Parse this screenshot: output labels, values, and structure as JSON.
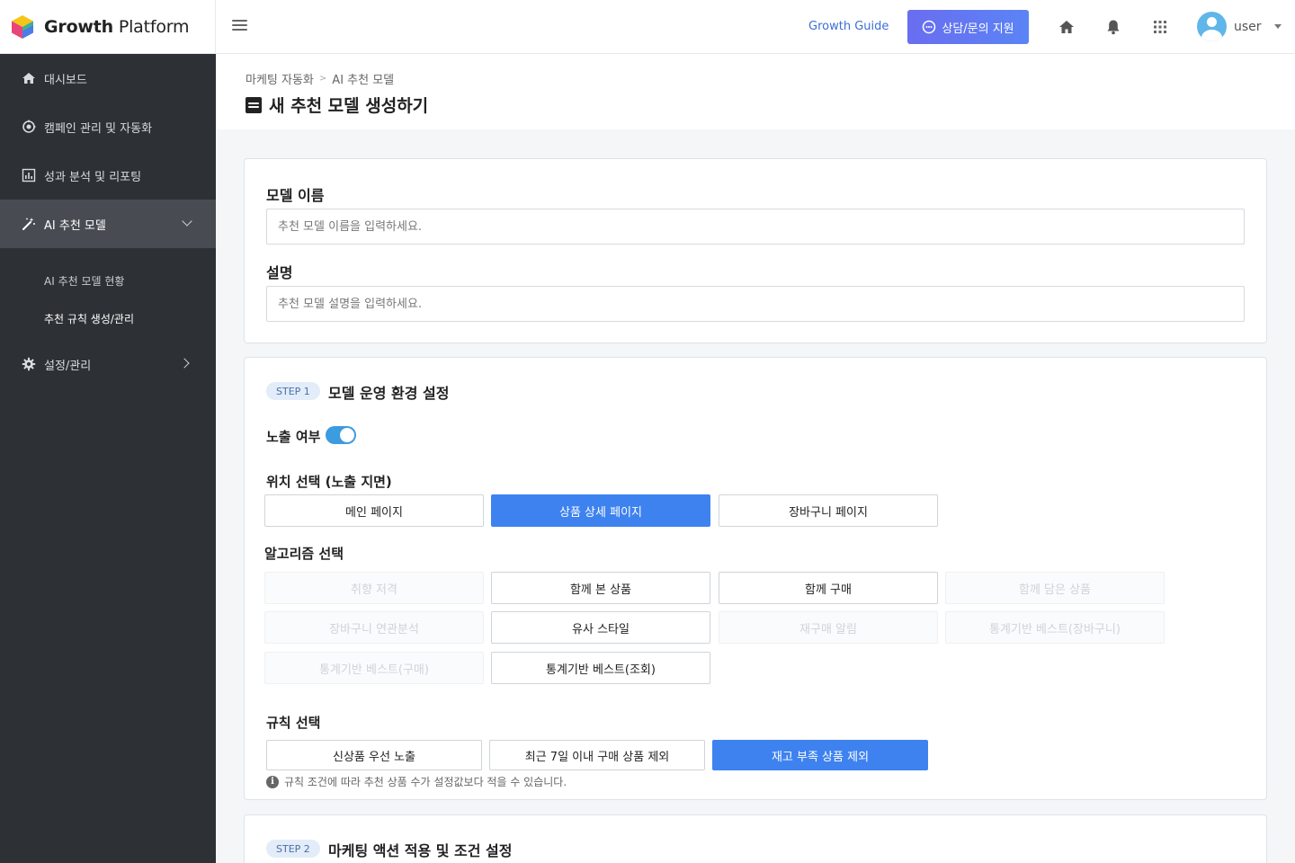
{
  "brand": {
    "name_bold": "Growth",
    "name_rest": " Platform"
  },
  "header": {
    "guide_label": "Growth Guide",
    "support_label": "상담/문의 지원",
    "user_name": "user"
  },
  "sidebar": {
    "items": [
      {
        "label": "대시보드"
      },
      {
        "label": "캠페인 관리 및 자동화"
      },
      {
        "label": "성과 분석 및 리포팅"
      },
      {
        "label": "AI 추천 모델"
      },
      {
        "label": "설정/관리"
      }
    ],
    "subitems": [
      {
        "label": "AI 추천 모델 현황"
      },
      {
        "label": "추천 규칙 생성/관리"
      }
    ]
  },
  "breadcrumb": [
    "마케팅 자동화",
    "AI 추천 모델"
  ],
  "page_title": "새 추천 모델 생성하기",
  "form": {
    "name_label": "모델 이름",
    "name_placeholder": "추천 모델 이름을 입력하세요.",
    "desc_label": "설명",
    "desc_placeholder": "추천 모델 설명을 입력하세요."
  },
  "step1": {
    "pill": "STEP 1",
    "title": "모델 운영 환경 설정",
    "toggle_label": "노출 여부",
    "toggle_on": true,
    "location_label": "위치 선택 (노출 지면)",
    "locations": [
      "메인 페이지",
      "상품 상세 페이지",
      "장바구니 페이지"
    ],
    "algo_label": "알고리즘 선택",
    "algorithms": [
      "취향 저격",
      "함께 본 상품",
      "함께 구매",
      "함께 담은 상품",
      "장바구니 연관분석",
      "유사 스타일",
      "재구매 알림",
      "통계기반 베스트(장바구니)",
      "통계기반 베스트(구매)",
      "통계기반 베스트(조회)"
    ],
    "rule_label": "규칙 선택",
    "rules": [
      "신상품 우선 노출",
      "최근 7일 이내 구매 상품 제외",
      "재고 부족 상품 제외"
    ],
    "note": "규칙 조건에 따라 추천 상품 수가 설정값보다 적을 수 있습니다."
  },
  "step2": {
    "pill": "STEP 2",
    "title": "마케팅 액션 적용 및 조건 설정"
  }
}
